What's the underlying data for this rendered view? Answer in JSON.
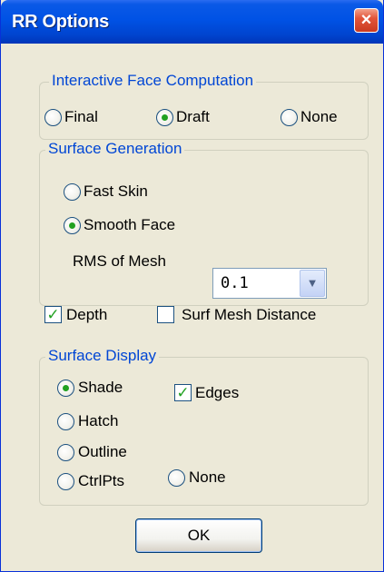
{
  "window": {
    "title": "RR Options",
    "close_glyph": "×"
  },
  "interactive_face": {
    "legend": "Interactive Face Computation",
    "options": [
      "Final",
      "Draft",
      "None"
    ],
    "selected": "Draft"
  },
  "surface_generation": {
    "legend": "Surface Generation",
    "options": [
      "Fast Skin",
      "Smooth Face"
    ],
    "selected": "Smooth Face",
    "rms_label": "RMS of Mesh",
    "rms_value": "0.1",
    "dropdown_glyph": "▼"
  },
  "depth": {
    "label": "Depth",
    "checked": true
  },
  "surf_mesh_distance": {
    "label": "Surf Mesh Distance",
    "checked": false
  },
  "surface_display": {
    "legend": "Surface Display",
    "options": [
      "Shade",
      "Hatch",
      "Outline",
      "CtrlPts",
      "None"
    ],
    "selected": "Shade",
    "edges_label": "Edges",
    "edges_checked": true
  },
  "check_glyph": "✓",
  "ok_label": "OK",
  "colors": {
    "title_bar": "#0052e5",
    "legend_text": "#0046d5",
    "dialog_bg": "#ece9d8",
    "radio_dot": "#21a121",
    "close_button": "#e2553a"
  }
}
